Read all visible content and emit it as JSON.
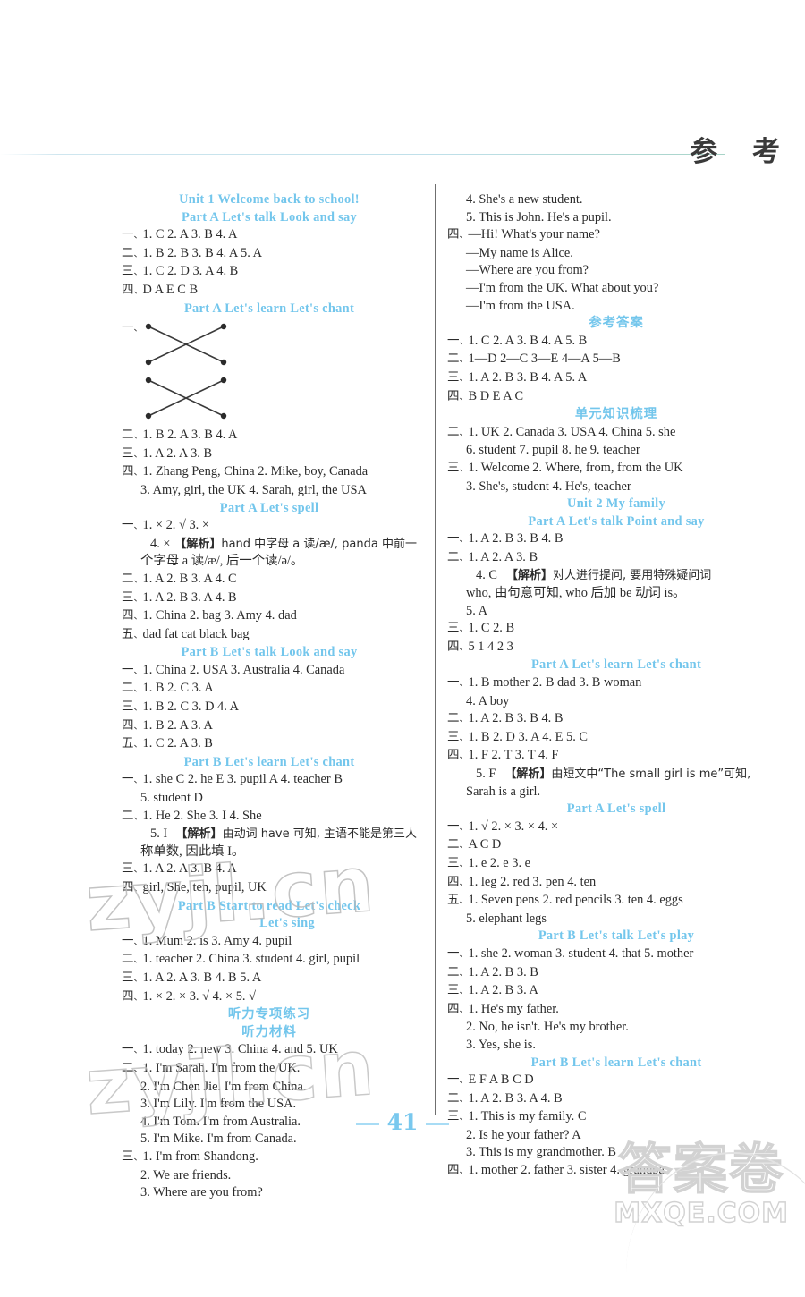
{
  "header": {
    "title": "参 考"
  },
  "page": {
    "number": "41"
  },
  "watermarks": {
    "left_1": "zyjl.cn",
    "left_2": "zyjl.cn",
    "bottom_cn": "答案卷",
    "bottom_en": "MXQE.COM"
  },
  "left_column": [
    {
      "kind": "heading",
      "text": "Unit 1   Welcome back to school!"
    },
    {
      "kind": "heading",
      "text": "Part A   Let's talk   Look and say"
    },
    {
      "kind": "answer",
      "num": "一",
      "text": "1. C   2. A   3. B   4. A"
    },
    {
      "kind": "answer",
      "num": "二",
      "text": "1. B   2. B   3. B   4. A   5. A"
    },
    {
      "kind": "answer",
      "num": "三",
      "text": "1. C   2. D   3. A   4. B"
    },
    {
      "kind": "answer",
      "num": "四",
      "text": "D   A   E   C   B"
    },
    {
      "kind": "heading",
      "text": "Part A   Let's learn   Let's chant"
    },
    {
      "kind": "match",
      "num": "一"
    },
    {
      "kind": "match2"
    },
    {
      "kind": "answer",
      "num": "二",
      "text": "1. B   2. A   3. B   4. A"
    },
    {
      "kind": "answer",
      "num": "三",
      "text": "1. A   2. A   3. B"
    },
    {
      "kind": "answer",
      "num": "四",
      "text": "1. Zhang Peng, China   2. Mike, boy, Canada"
    },
    {
      "kind": "cont",
      "text": "3. Amy, girl, the UK   4. Sarah, girl, the USA"
    },
    {
      "kind": "heading",
      "text": "Part A   Let's spell"
    },
    {
      "kind": "answer",
      "num": "一",
      "text": "1. ×   2. √   3. ×"
    },
    {
      "kind": "cont-jx",
      "lead": "4. ×",
      "tag": "【解析】",
      "text": "hand 中字母 a 读/æ/, panda 中前一"
    },
    {
      "kind": "cont",
      "text": "个字母 a 读/æ/, 后一个读/ə/。"
    },
    {
      "kind": "answer",
      "num": "二",
      "text": "1. A   2. B   3. A   4. C"
    },
    {
      "kind": "answer",
      "num": "三",
      "text": "1. A   2. B   3. A   4. B"
    },
    {
      "kind": "answer",
      "num": "四",
      "text": "1. China   2. bag   3. Amy   4. dad"
    },
    {
      "kind": "answer",
      "num": "五",
      "text": "dad   fat   cat   black   bag"
    },
    {
      "kind": "heading",
      "text": "Part B   Let's talk   Look and say"
    },
    {
      "kind": "answer",
      "num": "一",
      "text": "1. China   2. USA   3. Australia   4. Canada"
    },
    {
      "kind": "answer",
      "num": "二",
      "text": "1. B   2. C   3. A"
    },
    {
      "kind": "answer",
      "num": "三",
      "text": "1. B   2. C   3. D   4. A"
    },
    {
      "kind": "answer",
      "num": "四",
      "text": "1. B   2. A   3. A"
    },
    {
      "kind": "answer",
      "num": "五",
      "text": "1. C   2. A   3. B"
    },
    {
      "kind": "heading",
      "text": "Part B   Let's learn   Let's chant"
    },
    {
      "kind": "answer",
      "num": "一",
      "text": "1. she   C   2. he   E   3. pupil   A   4. teacher   B"
    },
    {
      "kind": "cont",
      "text": "5. student   D"
    },
    {
      "kind": "answer",
      "num": "二",
      "text": "1. He   2. She   3. I   4. She"
    },
    {
      "kind": "cont-jx",
      "lead": "5. I",
      "tag": "【解析】",
      "text": "由动词 have 可知, 主语不能是第三人"
    },
    {
      "kind": "cont",
      "text": "称单数, 因此填 I。"
    },
    {
      "kind": "answer",
      "num": "三",
      "text": "1. A   2. A   3. B   4. A"
    },
    {
      "kind": "answer",
      "num": "四",
      "text": "girl, She, ten, pupil, UK"
    },
    {
      "kind": "heading",
      "text": "Part B   Start to read   Let's check"
    },
    {
      "kind": "heading2",
      "text": "Let's sing"
    },
    {
      "kind": "answer",
      "num": "一",
      "text": "1. Mum   2. is   3. Amy   4. pupil"
    },
    {
      "kind": "answer",
      "num": "二",
      "text": "1. teacher   2. China   3. student   4. girl, pupil"
    },
    {
      "kind": "answer",
      "num": "三",
      "text": "1. A   2. A   3. B   4. B   5. A"
    },
    {
      "kind": "answer",
      "num": "四",
      "text": "1. ×   2. ×   3. √   4. ×   5. √"
    },
    {
      "kind": "heading-cn",
      "text": "听力专项练习"
    },
    {
      "kind": "heading-cn",
      "text": "听力材料"
    },
    {
      "kind": "answer",
      "num": "一",
      "text": "1. today   2. new   3. China   4. and   5. UK"
    },
    {
      "kind": "answer",
      "num": "二",
      "text": "1. I'm Sarah. I'm from the UK."
    },
    {
      "kind": "cont",
      "text": "2. I'm Chen Jie. I'm from China."
    },
    {
      "kind": "cont",
      "text": "3. I'm Lily. I'm from the USA."
    },
    {
      "kind": "cont",
      "text": "4. I'm Tom. I'm from Australia."
    },
    {
      "kind": "cont",
      "text": "5. I'm Mike. I'm from Canada."
    },
    {
      "kind": "answer",
      "num": "三",
      "text": "1. I'm from Shandong."
    },
    {
      "kind": "cont",
      "text": "2. We are friends."
    },
    {
      "kind": "cont",
      "text": "3. Where are you from?"
    }
  ],
  "right_column": [
    {
      "kind": "cont",
      "text": "4. She's a new student."
    },
    {
      "kind": "cont",
      "text": "5. This is John. He's a pupil."
    },
    {
      "kind": "answer",
      "num": "四",
      "text": "—Hi! What's your name?"
    },
    {
      "kind": "cont",
      "text": "—My name is Alice."
    },
    {
      "kind": "cont",
      "text": "—Where are you from?"
    },
    {
      "kind": "cont",
      "text": "—I'm from the UK. What about you?"
    },
    {
      "kind": "cont",
      "text": "—I'm from the USA."
    },
    {
      "kind": "heading-cn",
      "text": "参考答案"
    },
    {
      "kind": "answer",
      "num": "一",
      "text": "1. C   2. A   3. B   4. A   5. B"
    },
    {
      "kind": "answer",
      "num": "二",
      "text": "1—D   2—C   3—E   4—A   5—B"
    },
    {
      "kind": "answer",
      "num": "三",
      "text": "1. A   2. B   3. B   4. A   5. A"
    },
    {
      "kind": "answer",
      "num": "四",
      "text": "B   D   E   A   C"
    },
    {
      "kind": "heading-cn",
      "text": "单元知识梳理"
    },
    {
      "kind": "answer",
      "num": "二",
      "text": "1. UK   2. Canada   3. USA   4. China   5. she"
    },
    {
      "kind": "cont",
      "text": "6. student   7. pupil   8. he   9. teacher"
    },
    {
      "kind": "answer",
      "num": "三",
      "text": "1. Welcome   2. Where, from, from the UK"
    },
    {
      "kind": "cont",
      "text": "3. She's, student   4. He's, teacher"
    },
    {
      "kind": "heading",
      "text": "Unit 2   My family"
    },
    {
      "kind": "heading",
      "text": "Part A   Let's talk   Point and say"
    },
    {
      "kind": "answer",
      "num": "一",
      "text": "1. A   2. B   3. B   4. B"
    },
    {
      "kind": "answer",
      "num": "二",
      "text": "1. A   2. A   3. B"
    },
    {
      "kind": "cont-jx",
      "lead": "4. C",
      "tag": "【解析】",
      "text": "对人进行提问, 要用特殊疑问词"
    },
    {
      "kind": "cont",
      "text": "who, 由句意可知, who 后加 be 动词 is。"
    },
    {
      "kind": "cont",
      "text": "5. A"
    },
    {
      "kind": "answer",
      "num": "三",
      "text": "1. C   2. B"
    },
    {
      "kind": "answer",
      "num": "四",
      "text": "5   1   4   2   3"
    },
    {
      "kind": "heading",
      "text": "Part A   Let's learn   Let's chant"
    },
    {
      "kind": "answer",
      "num": "一",
      "text": "1. B   mother   2. B   dad   3. B   woman"
    },
    {
      "kind": "cont",
      "text": "4. A   boy"
    },
    {
      "kind": "answer",
      "num": "二",
      "text": "1. A   2. B   3. B   4. B"
    },
    {
      "kind": "answer",
      "num": "三",
      "text": "1. B   2. D   3. A   4. E   5. C"
    },
    {
      "kind": "answer",
      "num": "四",
      "text": "1. F   2. T   3. T   4. F"
    },
    {
      "kind": "cont-jx",
      "lead": "5. F",
      "tag": "【解析】",
      "text": "由短文中“The small girl is me”可知,"
    },
    {
      "kind": "cont",
      "text": "Sarah is a girl."
    },
    {
      "kind": "heading",
      "text": "Part A   Let's spell"
    },
    {
      "kind": "answer",
      "num": "一",
      "text": "1. √   2. ×   3. ×   4. ×"
    },
    {
      "kind": "answer",
      "num": "二",
      "text": "A   C   D"
    },
    {
      "kind": "answer",
      "num": "三",
      "text": "1. e   2. e   3. e"
    },
    {
      "kind": "answer",
      "num": "四",
      "text": "1. leg   2. red   3. pen   4. ten"
    },
    {
      "kind": "answer",
      "num": "五",
      "text": "1. Seven   pens   2. red   pencils   3. ten   4. eggs"
    },
    {
      "kind": "cont",
      "text": "5. elephant   legs"
    },
    {
      "kind": "heading",
      "text": "Part B   Let's talk   Let's play"
    },
    {
      "kind": "answer",
      "num": "一",
      "text": "1. she   2. woman   3. student   4. that   5. mother"
    },
    {
      "kind": "answer",
      "num": "二",
      "text": "1. A   2. B   3. B"
    },
    {
      "kind": "answer",
      "num": "三",
      "text": "1. A   2. B   3. A"
    },
    {
      "kind": "answer",
      "num": "四",
      "text": "1. He's my father."
    },
    {
      "kind": "cont",
      "text": "2. No, he isn't. He's my brother."
    },
    {
      "kind": "cont",
      "text": "3. Yes, she is."
    },
    {
      "kind": "heading",
      "text": "Part B   Let's learn   Let's chant"
    },
    {
      "kind": "answer",
      "num": "一",
      "text": "E   F   A   B   C   D"
    },
    {
      "kind": "answer",
      "num": "二",
      "text": "1. A   2. B   3. A   4. B"
    },
    {
      "kind": "answer",
      "num": "三",
      "text": "1. This is my family.    C"
    },
    {
      "kind": "cont",
      "text": "2. Is he your father?    A"
    },
    {
      "kind": "cont",
      "text": "3. This is my grandmother.    B"
    },
    {
      "kind": "answer",
      "num": "四",
      "text": "1. mother   2. father   3. sister   4. grandpa"
    }
  ]
}
